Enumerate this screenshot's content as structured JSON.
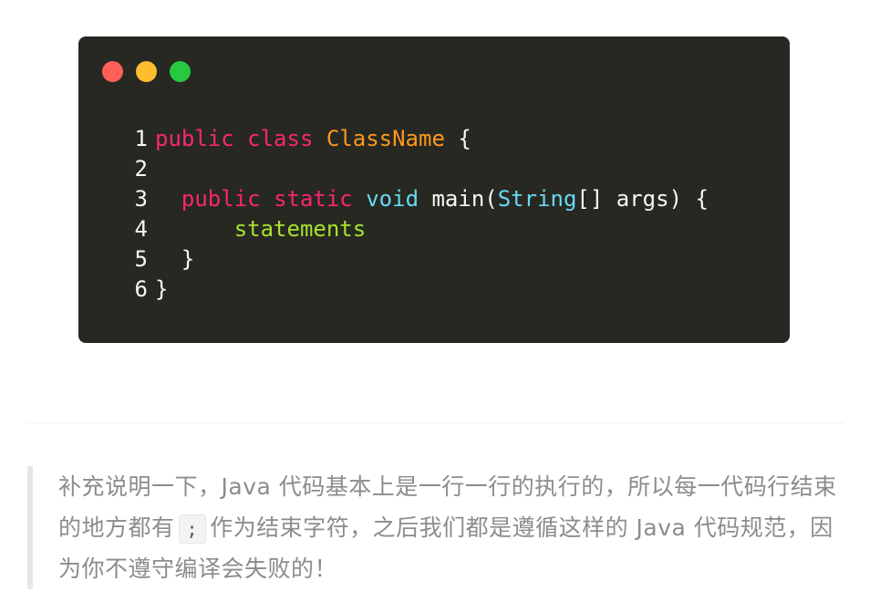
{
  "colors": {
    "code_bg": "#272822",
    "dot_red": "#ff5f56",
    "dot_yellow": "#ffbd2e",
    "dot_green": "#27c93f",
    "keyword": "#f92672",
    "class_name": "#fd971f",
    "type": "#66d9ef",
    "function": "#a6e22e",
    "plain": "#f8f8f2",
    "quote_text": "#8c8c8c",
    "quote_border": "#e6e6e6"
  },
  "window_controls": {
    "close": "close-dot",
    "minimize": "minimize-dot",
    "maximize": "maximize-dot"
  },
  "code": {
    "lines": [
      {
        "number": "1",
        "tokens": [
          "public",
          "class",
          "ClassName",
          "{"
        ]
      },
      {
        "number": "2",
        "tokens": []
      },
      {
        "number": "3",
        "tokens": [
          "public",
          "static",
          "void",
          "main",
          "(",
          "String",
          "[]",
          "args",
          ")",
          "{"
        ]
      },
      {
        "number": "4",
        "tokens": [
          "statements"
        ]
      },
      {
        "number": "5",
        "tokens": [
          "}"
        ]
      },
      {
        "number": "6",
        "tokens": [
          "}"
        ]
      }
    ]
  },
  "quote": {
    "text_before": "补充说明一下，Java 代码基本上是一行一行的执行的，所以每一代码行结束的地方都有",
    "inline_code": ";",
    "text_after": "作为结束字符，之后我们都是遵循这样的 Java 代码规范，因为你不遵守编译会失败的！"
  }
}
